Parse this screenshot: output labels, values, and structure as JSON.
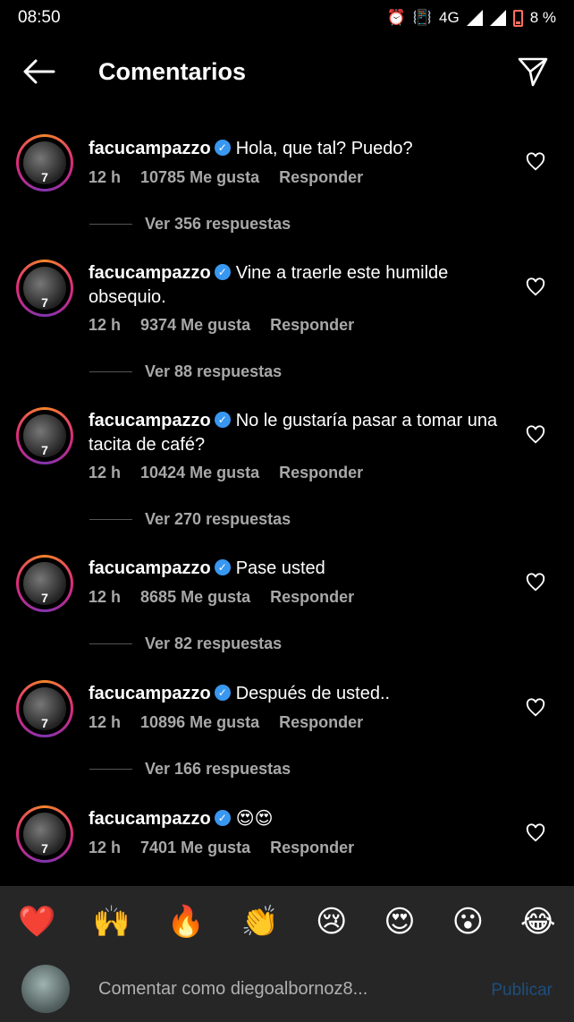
{
  "status_bar": {
    "time": "08:50",
    "network": "4G",
    "battery": "8 %"
  },
  "header": {
    "title": "Comentarios"
  },
  "comments": [
    {
      "username": "facucampazzo",
      "text": "Hola, que tal? Puedo?",
      "time": "12 h",
      "likes": "10785 Me gusta",
      "reply_label": "Responder",
      "replies_label": "Ver 356 respuestas"
    },
    {
      "username": "facucampazzo",
      "text": "Vine a traerle este humilde obsequio.",
      "time": "12 h",
      "likes": "9374 Me gusta",
      "reply_label": "Responder",
      "replies_label": "Ver 88 respuestas"
    },
    {
      "username": "facucampazzo",
      "text": "No le gustaría pasar a tomar una tacita de café?",
      "time": "12 h",
      "likes": "10424 Me gusta",
      "reply_label": "Responder",
      "replies_label": "Ver 270 respuestas"
    },
    {
      "username": "facucampazzo",
      "text": "Pase usted",
      "time": "12 h",
      "likes": "8685 Me gusta",
      "reply_label": "Responder",
      "replies_label": "Ver 82 respuestas"
    },
    {
      "username": "facucampazzo",
      "text": "Después de usted..",
      "time": "12 h",
      "likes": "10896 Me gusta",
      "reply_label": "Responder",
      "replies_label": "Ver 166 respuestas"
    },
    {
      "username": "facucampazzo",
      "text": "😍😍",
      "time": "12 h",
      "likes": "7401 Me gusta",
      "reply_label": "Responder"
    }
  ],
  "emoji_bar": [
    "❤️",
    "🙌",
    "🔥",
    "👏",
    "😢",
    "😍",
    "😮",
    "😂"
  ],
  "composer": {
    "placeholder": "Comentar como diegoalbornoz8...",
    "publish_label": "Publicar"
  },
  "colors": {
    "background": "#000000",
    "secondary_text": "#a8a8a8",
    "verified": "#3897f0",
    "bottom_bar": "#262626",
    "publish_disabled": "#1c4f7f"
  }
}
